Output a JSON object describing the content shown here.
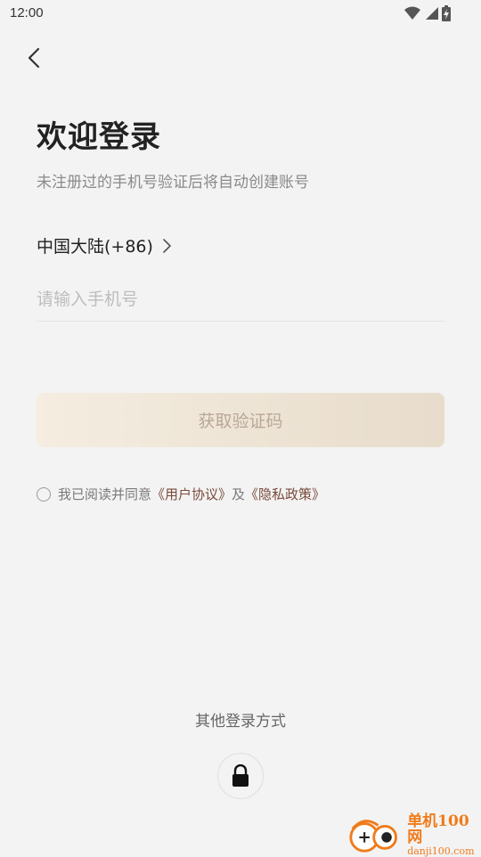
{
  "status_bar": {
    "time": "12:00"
  },
  "header": {
    "back_icon": "chevron-left-icon"
  },
  "login": {
    "title": "欢迎登录",
    "subtitle": "未注册过的手机号验证后将自动创建账号",
    "region_label": "中国大陆(+86)",
    "phone_placeholder": "请输入手机号",
    "phone_value": "",
    "get_code_button": "获取验证码",
    "agreement": {
      "prefix": "我已阅读并同意",
      "user_agreement": "《用户协议》",
      "connector": "及",
      "privacy_policy": "《隐私政策》"
    }
  },
  "other_login": {
    "label": "其他登录方式",
    "icon": "lock-icon"
  },
  "watermark": {
    "name": "单机100网",
    "domain": "danji100.com"
  },
  "colors": {
    "background": "#f3f3f3",
    "button_gradient_start": "#f4ede0",
    "button_gradient_end": "#e8dccb",
    "button_text": "#b9a898",
    "link": "#7a4a3c",
    "watermark": "#f07b1a"
  }
}
